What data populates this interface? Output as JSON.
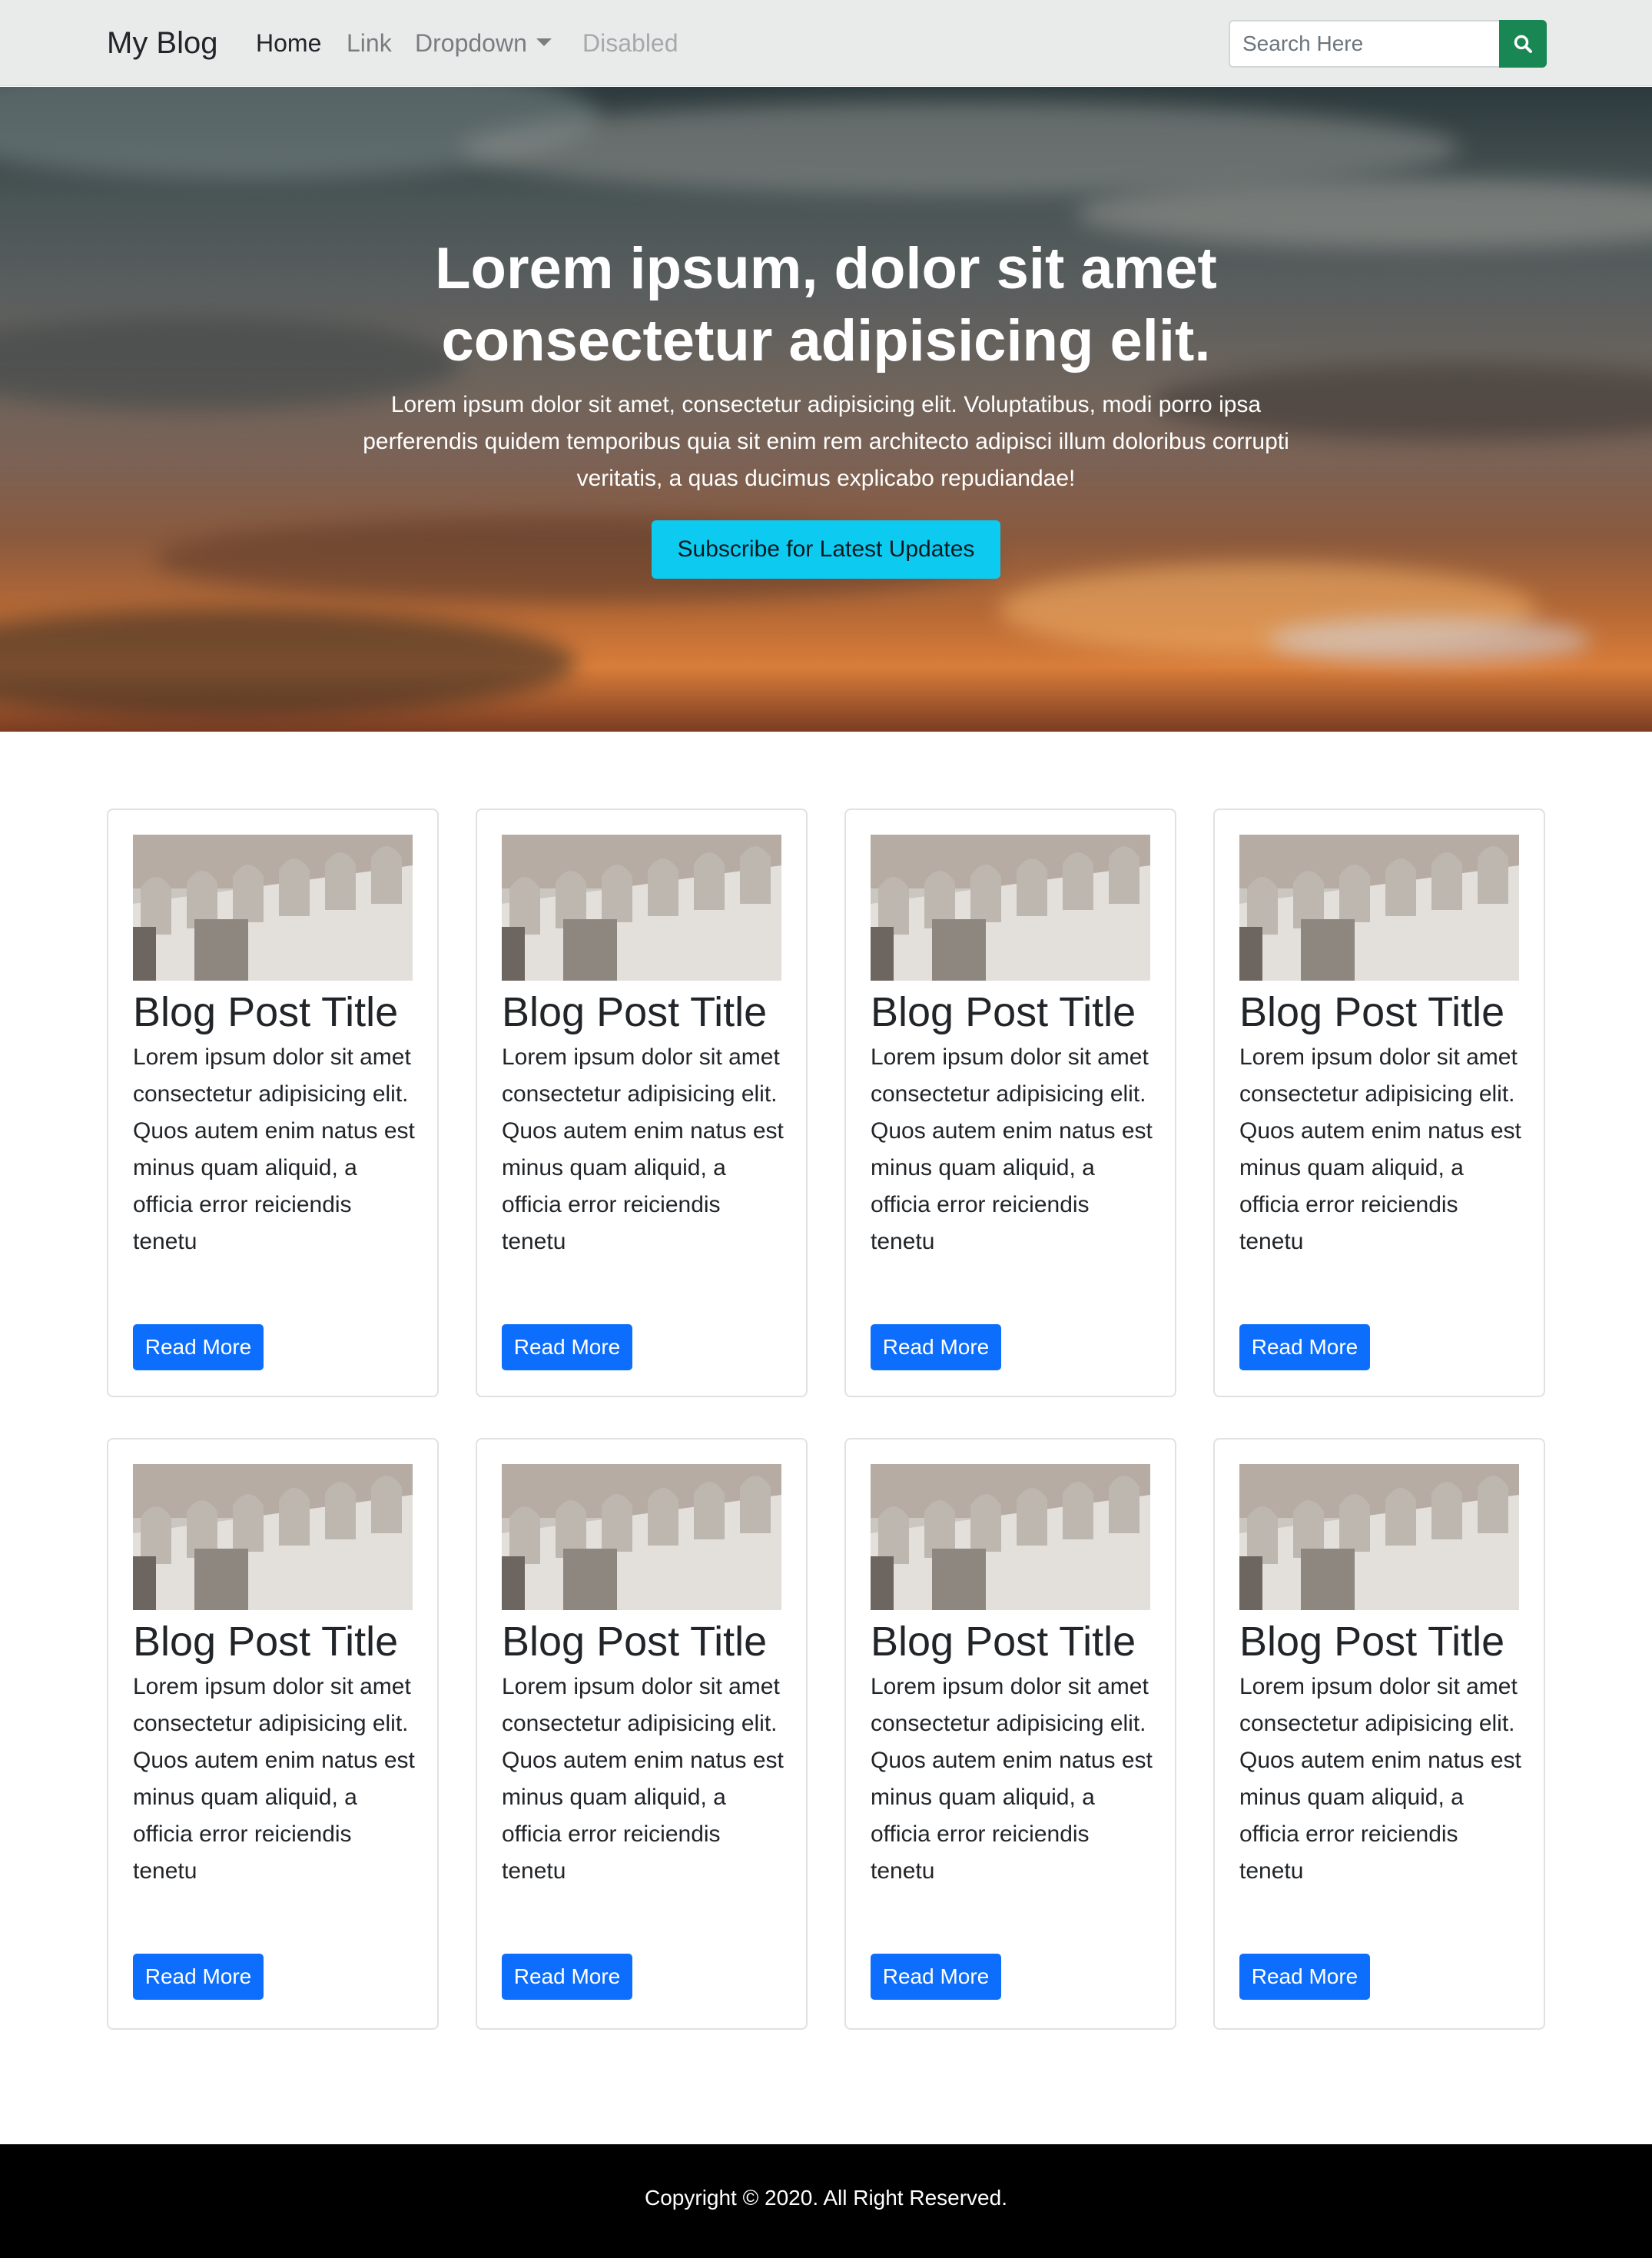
{
  "navbar": {
    "brand": "My Blog",
    "links": [
      {
        "label": "Home"
      },
      {
        "label": "Link"
      },
      {
        "label": "Dropdown"
      },
      {
        "label": "Disabled"
      }
    ],
    "search": {
      "placeholder": "Search Here",
      "value": ""
    },
    "search_icon": "search-icon"
  },
  "hero": {
    "title_line1": "Lorem ipsum, dolor sit amet",
    "title_line2": "consectetur adipisicing elit.",
    "text": "Lorem ipsum dolor sit amet, consectetur adipisicing elit. Voluptatibus, modi porro ipsa perferendis quidem temporibus quia sit enim rem architecto adipisci illum doloribus corrupti veritatis, a quas ducimus explicabo repudiandae!",
    "button": "Subscribe for Latest Updates"
  },
  "posts": [
    {
      "title": "Blog Post Title",
      "text": "Lorem ipsum dolor sit amet consectetur adipisicing elit. Quos autem enim natus est minus quam aliquid, a officia error reiciendis tenetu",
      "button": "Read More"
    },
    {
      "title": "Blog Post Title",
      "text": "Lorem ipsum dolor sit amet consectetur adipisicing elit. Quos autem enim natus est minus quam aliquid, a officia error reiciendis tenetu",
      "button": "Read More"
    },
    {
      "title": "Blog Post Title",
      "text": "Lorem ipsum dolor sit amet consectetur adipisicing elit. Quos autem enim natus est minus quam aliquid, a officia error reiciendis tenetu",
      "button": "Read More"
    },
    {
      "title": "Blog Post Title",
      "text": "Lorem ipsum dolor sit amet consectetur adipisicing elit. Quos autem enim natus est minus quam aliquid, a officia error reiciendis tenetu",
      "button": "Read More"
    },
    {
      "title": "Blog Post Title",
      "text": "Lorem ipsum dolor sit amet consectetur adipisicing elit. Quos autem enim natus est minus quam aliquid, a officia error reiciendis tenetu",
      "button": "Read More"
    },
    {
      "title": "Blog Post Title",
      "text": "Lorem ipsum dolor sit amet consectetur adipisicing elit. Quos autem enim natus est minus quam aliquid, a officia error reiciendis tenetu",
      "button": "Read More"
    },
    {
      "title": "Blog Post Title",
      "text": "Lorem ipsum dolor sit amet consectetur adipisicing elit. Quos autem enim natus est minus quam aliquid, a officia error reiciendis tenetu",
      "button": "Read More"
    },
    {
      "title": "Blog Post Title",
      "text": "Lorem ipsum dolor sit amet consectetur adipisicing elit. Quos autem enim natus est minus quam aliquid, a officia error reiciendis tenetu",
      "button": "Read More"
    }
  ],
  "footer": {
    "copyright": "Copyright © 2020. All Right Reserved."
  },
  "colors": {
    "navbar_bg": "#e9eaea",
    "search_button": "#198754",
    "hero_button": "#0dcaf0",
    "read_more_button": "#0d6efd",
    "footer_bg": "#000000"
  }
}
